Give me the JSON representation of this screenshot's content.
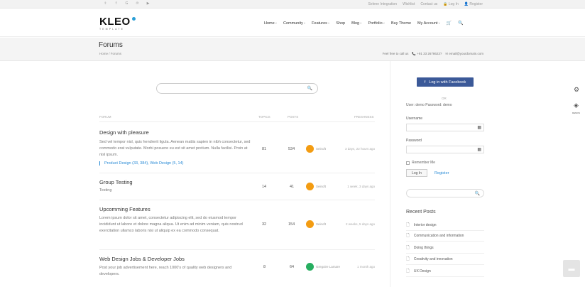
{
  "topbar": {
    "social": [
      "𝕥",
      "f",
      "G",
      "℗",
      "▶"
    ],
    "links": [
      "Selene Integration",
      "Wishlist",
      "Contact us",
      "🔒 Log In",
      "👤 Register"
    ]
  },
  "header": {
    "logo": "KLEO",
    "logo_sub": "TEMPLATE",
    "nav": [
      {
        "label": "Home",
        "caret": "˅"
      },
      {
        "label": "Community",
        "caret": "˅"
      },
      {
        "label": "Features",
        "caret": "˅"
      },
      {
        "label": "Shop",
        "caret": ""
      },
      {
        "label": "Blog",
        "caret": "˅"
      },
      {
        "label": "Portfolio",
        "caret": "˅"
      },
      {
        "label": "Buy Theme",
        "caret": ""
      },
      {
        "label": "My Account",
        "caret": "˅"
      }
    ],
    "cart_icon": "🛒",
    "search_icon": "🔍"
  },
  "titleband": {
    "title": "Forums",
    "breadcrumb": "Home / Forums",
    "contact_prefix": "Feel free to call us",
    "phone": "📞 +91 33 2678623?",
    "email": "✉ email@yourdomain.com"
  },
  "search": {
    "placeholder": "",
    "icon": "🔍"
  },
  "table": {
    "headers": {
      "forum": "FORUM",
      "topics": "TOPICS",
      "posts": "POSTS",
      "freshness": "FRESHNESS"
    },
    "rows": [
      {
        "name": "Design with pleasure",
        "desc": "Sed vel tempor nisl, quis hendrerit ligula. Aenean mattis sapien in nibh consectetur, sed commodo erat vulputate. Morbi posuere eu est sit amet pretium. Nulla facilisi. Proin at nisl ipsum.",
        "sub": "Product Design (33, 384), Web Design (5, 14)",
        "topics": "81",
        "posts": "534",
        "user": "Seinoft",
        "time": "3 days, 22 hours ago",
        "avatar_color": "#f39c12"
      },
      {
        "name": "Group Testing",
        "desc": "Testing",
        "sub": "",
        "topics": "14",
        "posts": "41",
        "user": "Seinoft",
        "time": "1 week, 3 days ago",
        "avatar_color": "#f39c12"
      },
      {
        "name": "Upcomming Features",
        "desc": "Lorem ipsum dolor sit amet, consectetur adipiscing elit, sed do eiusmod tempor incididunt ut labore et dolore magna aliqua. Ut enim ad minim veniam, quis nostrud exercitation ullamco laboris nisi ut aliquip ex ea commodo consequat.",
        "sub": "",
        "topics": "32",
        "posts": "154",
        "user": "Seinoft",
        "time": "2 weeks, 5 days ago",
        "avatar_color": "#f39c12"
      },
      {
        "name": "Web Design Jobs & Developer Jobs",
        "desc": "Post your job advertisement here, reach 1000's of quality web designers and developers.",
        "sub": "",
        "topics": "8",
        "posts": "64",
        "user": "Gregoire Lamare",
        "time": "1 month ago",
        "avatar_color": "#27ae60"
      }
    ]
  },
  "sidebar": {
    "fb_button": "Log in with Facebook",
    "fb_icon": "f",
    "or": "OR",
    "demo": "User: demo Password: demo",
    "username_label": "Username",
    "password_label": "Password",
    "remember": "Remember Me",
    "login_button": "Log In",
    "register": "Register",
    "search_icon": "🔍",
    "recent_title": "Recent Posts",
    "recent_posts": [
      "Interior design",
      "Communication and information",
      "Doing things",
      "Creativity and innovation",
      "UX Design"
    ]
  },
  "tools": {
    "gear_icon": "⚙",
    "layers_icon": "◈",
    "layers_label": "DEMOS",
    "scroll_icon": "▬"
  }
}
